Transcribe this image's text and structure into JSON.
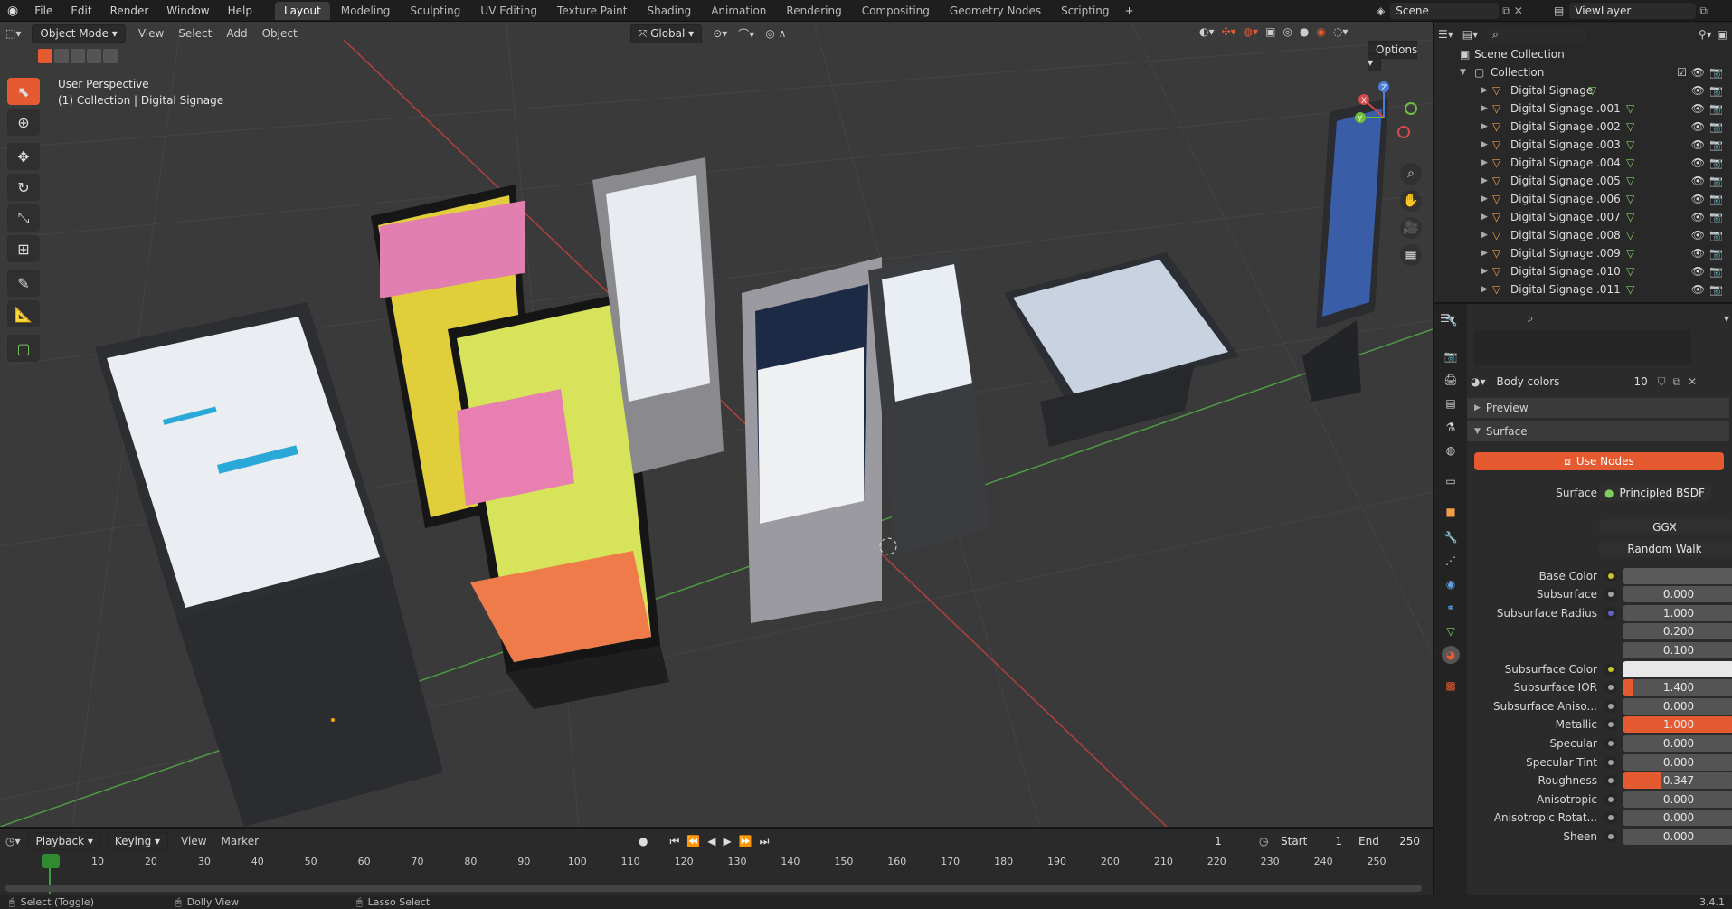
{
  "menu": [
    "File",
    "Edit",
    "Render",
    "Window",
    "Help"
  ],
  "workspaces": [
    "Layout",
    "Modeling",
    "Sculpting",
    "UV Editing",
    "Texture Paint",
    "Shading",
    "Animation",
    "Rendering",
    "Compositing",
    "Geometry Nodes",
    "Scripting"
  ],
  "active_workspace": "Layout",
  "scene": "Scene",
  "view_layer": "ViewLayer",
  "viewport": {
    "mode": "Object Mode",
    "menus": [
      "View",
      "Select",
      "Add",
      "Object"
    ],
    "orientation": "Global",
    "options_label": "Options",
    "overlay_line1": "User Perspective",
    "overlay_line2": "(1) Collection | Digital Signage"
  },
  "outliner": {
    "root": "Scene Collection",
    "collection": "Collection",
    "objects": [
      "Digital Signage",
      "Digital Signage .001",
      "Digital Signage .002",
      "Digital Signage .003",
      "Digital Signage .004",
      "Digital Signage .005",
      "Digital Signage .006",
      "Digital Signage .007",
      "Digital Signage .008",
      "Digital Signage .009",
      "Digital Signage .010",
      "Digital Signage .011"
    ]
  },
  "properties": {
    "material_name": "Body colors",
    "user_count": "10",
    "preview_label": "Preview",
    "surface_section": "Surface",
    "use_nodes": "Use Nodes",
    "surface_label": "Surface",
    "surface_value": "Principled BSDF",
    "distribution": "GGX",
    "subsurface_method": "Random Walk",
    "rows": [
      {
        "label": "Base Color",
        "value": "",
        "type": "color",
        "color": "#5a5a5a"
      },
      {
        "label": "Subsurface",
        "value": "0.000",
        "type": "num",
        "fill": 0
      },
      {
        "label": "Subsurface Radius",
        "value": "1.000",
        "type": "num",
        "fill": 0
      },
      {
        "label": "",
        "value": "0.200",
        "type": "num",
        "fill": 0
      },
      {
        "label": "",
        "value": "0.100",
        "type": "num",
        "fill": 0
      },
      {
        "label": "Subsurface Color",
        "value": "",
        "type": "color",
        "color": "#e8e8e8"
      },
      {
        "label": "Subsurface IOR",
        "value": "1.400",
        "type": "num",
        "fill": 0.1
      },
      {
        "label": "Subsurface Aniso...",
        "value": "0.000",
        "type": "num",
        "fill": 0
      },
      {
        "label": "Metallic",
        "value": "1.000",
        "type": "num",
        "fill": 1
      },
      {
        "label": "Specular",
        "value": "0.000",
        "type": "num",
        "fill": 0
      },
      {
        "label": "Specular Tint",
        "value": "0.000",
        "type": "num",
        "fill": 0
      },
      {
        "label": "Roughness",
        "value": "0.347",
        "type": "num",
        "fill": 0.347
      },
      {
        "label": "Anisotropic",
        "value": "0.000",
        "type": "num",
        "fill": 0
      },
      {
        "label": "Anisotropic Rotat...",
        "value": "0.000",
        "type": "num",
        "fill": 0
      },
      {
        "label": "Sheen",
        "value": "0.000",
        "type": "num",
        "fill": 0
      }
    ]
  },
  "timeline": {
    "menus": [
      "Playback",
      "Keying",
      "View",
      "Marker"
    ],
    "current_frame": "1",
    "start_label": "Start",
    "start": "1",
    "end_label": "End",
    "end": "250",
    "ticks": [
      "1",
      "10",
      "20",
      "30",
      "40",
      "50",
      "60",
      "70",
      "80",
      "90",
      "100",
      "110",
      "120",
      "130",
      "140",
      "150",
      "160",
      "170",
      "180",
      "190",
      "200",
      "210",
      "220",
      "230",
      "240",
      "250"
    ]
  },
  "statusbar": {
    "left": "Select (Toggle)",
    "middle": "Dolly View",
    "right": "Lasso Select",
    "version": "3.4.1"
  },
  "colors": {
    "accent": "#e65a32",
    "active_tool": "#5680c2",
    "mesh_icon": "#7fcf5f",
    "object_icon": "#f29d49"
  }
}
